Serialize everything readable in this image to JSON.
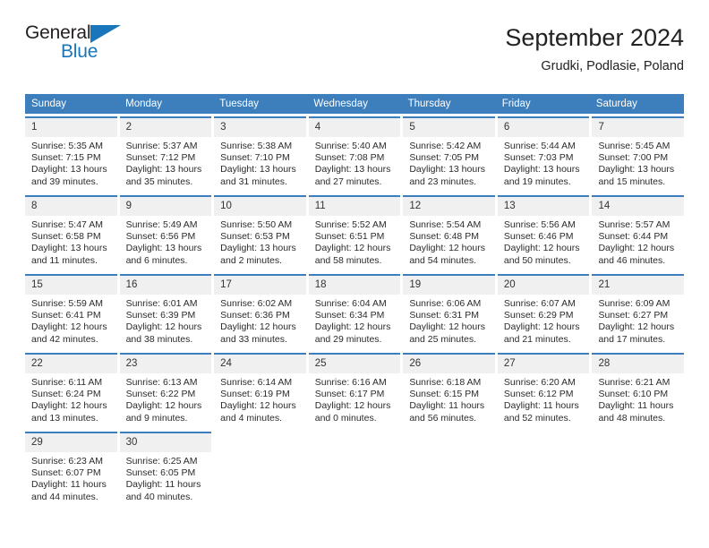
{
  "brand": {
    "name_part1": "General",
    "name_part2": "Blue",
    "triangle_icon": "triangle-icon",
    "accent_color": "#1b75bb"
  },
  "header": {
    "title": "September 2024",
    "subtitle": "Grudki, Podlasie, Poland"
  },
  "calendar": {
    "header_bg_color": "#3d7ebd",
    "day_number_bg_color": "#f0f0f0",
    "weekdays": [
      "Sunday",
      "Monday",
      "Tuesday",
      "Wednesday",
      "Thursday",
      "Friday",
      "Saturday"
    ],
    "weeks": [
      [
        {
          "day": "1",
          "sunrise": "Sunrise: 5:35 AM",
          "sunset": "Sunset: 7:15 PM",
          "daylight": "Daylight: 13 hours and 39 minutes."
        },
        {
          "day": "2",
          "sunrise": "Sunrise: 5:37 AM",
          "sunset": "Sunset: 7:12 PM",
          "daylight": "Daylight: 13 hours and 35 minutes."
        },
        {
          "day": "3",
          "sunrise": "Sunrise: 5:38 AM",
          "sunset": "Sunset: 7:10 PM",
          "daylight": "Daylight: 13 hours and 31 minutes."
        },
        {
          "day": "4",
          "sunrise": "Sunrise: 5:40 AM",
          "sunset": "Sunset: 7:08 PM",
          "daylight": "Daylight: 13 hours and 27 minutes."
        },
        {
          "day": "5",
          "sunrise": "Sunrise: 5:42 AM",
          "sunset": "Sunset: 7:05 PM",
          "daylight": "Daylight: 13 hours and 23 minutes."
        },
        {
          "day": "6",
          "sunrise": "Sunrise: 5:44 AM",
          "sunset": "Sunset: 7:03 PM",
          "daylight": "Daylight: 13 hours and 19 minutes."
        },
        {
          "day": "7",
          "sunrise": "Sunrise: 5:45 AM",
          "sunset": "Sunset: 7:00 PM",
          "daylight": "Daylight: 13 hours and 15 minutes."
        }
      ],
      [
        {
          "day": "8",
          "sunrise": "Sunrise: 5:47 AM",
          "sunset": "Sunset: 6:58 PM",
          "daylight": "Daylight: 13 hours and 11 minutes."
        },
        {
          "day": "9",
          "sunrise": "Sunrise: 5:49 AM",
          "sunset": "Sunset: 6:56 PM",
          "daylight": "Daylight: 13 hours and 6 minutes."
        },
        {
          "day": "10",
          "sunrise": "Sunrise: 5:50 AM",
          "sunset": "Sunset: 6:53 PM",
          "daylight": "Daylight: 13 hours and 2 minutes."
        },
        {
          "day": "11",
          "sunrise": "Sunrise: 5:52 AM",
          "sunset": "Sunset: 6:51 PM",
          "daylight": "Daylight: 12 hours and 58 minutes."
        },
        {
          "day": "12",
          "sunrise": "Sunrise: 5:54 AM",
          "sunset": "Sunset: 6:48 PM",
          "daylight": "Daylight: 12 hours and 54 minutes."
        },
        {
          "day": "13",
          "sunrise": "Sunrise: 5:56 AM",
          "sunset": "Sunset: 6:46 PM",
          "daylight": "Daylight: 12 hours and 50 minutes."
        },
        {
          "day": "14",
          "sunrise": "Sunrise: 5:57 AM",
          "sunset": "Sunset: 6:44 PM",
          "daylight": "Daylight: 12 hours and 46 minutes."
        }
      ],
      [
        {
          "day": "15",
          "sunrise": "Sunrise: 5:59 AM",
          "sunset": "Sunset: 6:41 PM",
          "daylight": "Daylight: 12 hours and 42 minutes."
        },
        {
          "day": "16",
          "sunrise": "Sunrise: 6:01 AM",
          "sunset": "Sunset: 6:39 PM",
          "daylight": "Daylight: 12 hours and 38 minutes."
        },
        {
          "day": "17",
          "sunrise": "Sunrise: 6:02 AM",
          "sunset": "Sunset: 6:36 PM",
          "daylight": "Daylight: 12 hours and 33 minutes."
        },
        {
          "day": "18",
          "sunrise": "Sunrise: 6:04 AM",
          "sunset": "Sunset: 6:34 PM",
          "daylight": "Daylight: 12 hours and 29 minutes."
        },
        {
          "day": "19",
          "sunrise": "Sunrise: 6:06 AM",
          "sunset": "Sunset: 6:31 PM",
          "daylight": "Daylight: 12 hours and 25 minutes."
        },
        {
          "day": "20",
          "sunrise": "Sunrise: 6:07 AM",
          "sunset": "Sunset: 6:29 PM",
          "daylight": "Daylight: 12 hours and 21 minutes."
        },
        {
          "day": "21",
          "sunrise": "Sunrise: 6:09 AM",
          "sunset": "Sunset: 6:27 PM",
          "daylight": "Daylight: 12 hours and 17 minutes."
        }
      ],
      [
        {
          "day": "22",
          "sunrise": "Sunrise: 6:11 AM",
          "sunset": "Sunset: 6:24 PM",
          "daylight": "Daylight: 12 hours and 13 minutes."
        },
        {
          "day": "23",
          "sunrise": "Sunrise: 6:13 AM",
          "sunset": "Sunset: 6:22 PM",
          "daylight": "Daylight: 12 hours and 9 minutes."
        },
        {
          "day": "24",
          "sunrise": "Sunrise: 6:14 AM",
          "sunset": "Sunset: 6:19 PM",
          "daylight": "Daylight: 12 hours and 4 minutes."
        },
        {
          "day": "25",
          "sunrise": "Sunrise: 6:16 AM",
          "sunset": "Sunset: 6:17 PM",
          "daylight": "Daylight: 12 hours and 0 minutes."
        },
        {
          "day": "26",
          "sunrise": "Sunrise: 6:18 AM",
          "sunset": "Sunset: 6:15 PM",
          "daylight": "Daylight: 11 hours and 56 minutes."
        },
        {
          "day": "27",
          "sunrise": "Sunrise: 6:20 AM",
          "sunset": "Sunset: 6:12 PM",
          "daylight": "Daylight: 11 hours and 52 minutes."
        },
        {
          "day": "28",
          "sunrise": "Sunrise: 6:21 AM",
          "sunset": "Sunset: 6:10 PM",
          "daylight": "Daylight: 11 hours and 48 minutes."
        }
      ],
      [
        {
          "day": "29",
          "sunrise": "Sunrise: 6:23 AM",
          "sunset": "Sunset: 6:07 PM",
          "daylight": "Daylight: 11 hours and 44 minutes."
        },
        {
          "day": "30",
          "sunrise": "Sunrise: 6:25 AM",
          "sunset": "Sunset: 6:05 PM",
          "daylight": "Daylight: 11 hours and 40 minutes."
        },
        {
          "day": "",
          "sunrise": "",
          "sunset": "",
          "daylight": ""
        },
        {
          "day": "",
          "sunrise": "",
          "sunset": "",
          "daylight": ""
        },
        {
          "day": "",
          "sunrise": "",
          "sunset": "",
          "daylight": ""
        },
        {
          "day": "",
          "sunrise": "",
          "sunset": "",
          "daylight": ""
        },
        {
          "day": "",
          "sunrise": "",
          "sunset": "",
          "daylight": ""
        }
      ]
    ]
  }
}
